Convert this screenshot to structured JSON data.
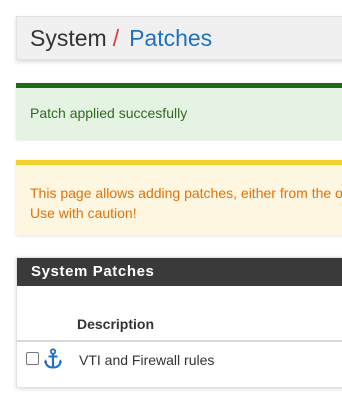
{
  "breadcrumb": {
    "root": "System",
    "separator": "/",
    "current": "Patches"
  },
  "alerts": {
    "success": "Patch applied succesfully",
    "warning_line1": "This page allows adding patches, either from the o",
    "warning_line2": "Use with caution!"
  },
  "panel": {
    "title": "System Patches",
    "column_header": "Description",
    "rows": [
      {
        "label": "VTI and Firewall rules",
        "icon": "anchor-icon",
        "checked": false
      }
    ]
  },
  "colors": {
    "success_border": "#1a6c1a",
    "success_bg": "#e5f3e2",
    "warning_border": "#f2d22a",
    "warning_text": "#e2720a",
    "panel_heading_bg": "#3a3a3a",
    "link_blue": "#1f71c2",
    "separator_red": "#e23a3a"
  }
}
